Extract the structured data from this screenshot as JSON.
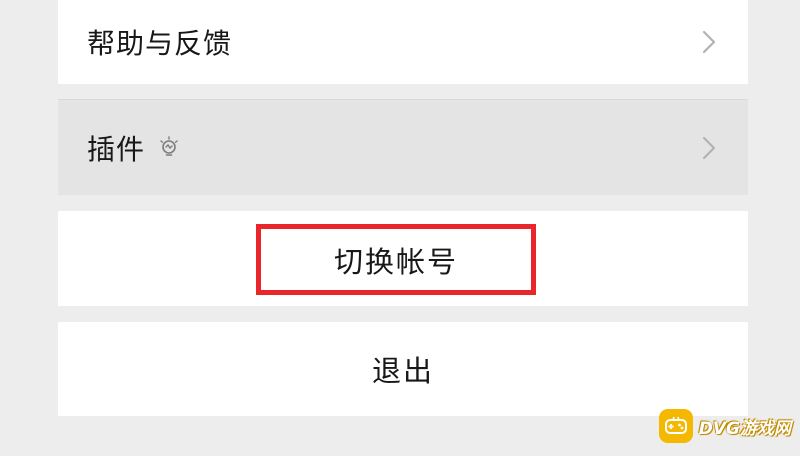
{
  "settings": {
    "help_label": "帮助与反馈",
    "plugin_label": "插件",
    "switch_account_label": "切换帐号",
    "logout_label": "退出"
  },
  "icons": {
    "help_chevron": "chevron-right-icon",
    "plugin_chevron": "chevron-right-icon",
    "plugin_badge": "lightbulb-icon"
  },
  "watermark": {
    "text": "DVG游戏网"
  },
  "colors": {
    "background": "#ededed",
    "panel": "#ffffff",
    "pressed_row": "#e4e4e4",
    "highlight_box": "#e8262b",
    "watermark_badge": "#f5b800"
  }
}
